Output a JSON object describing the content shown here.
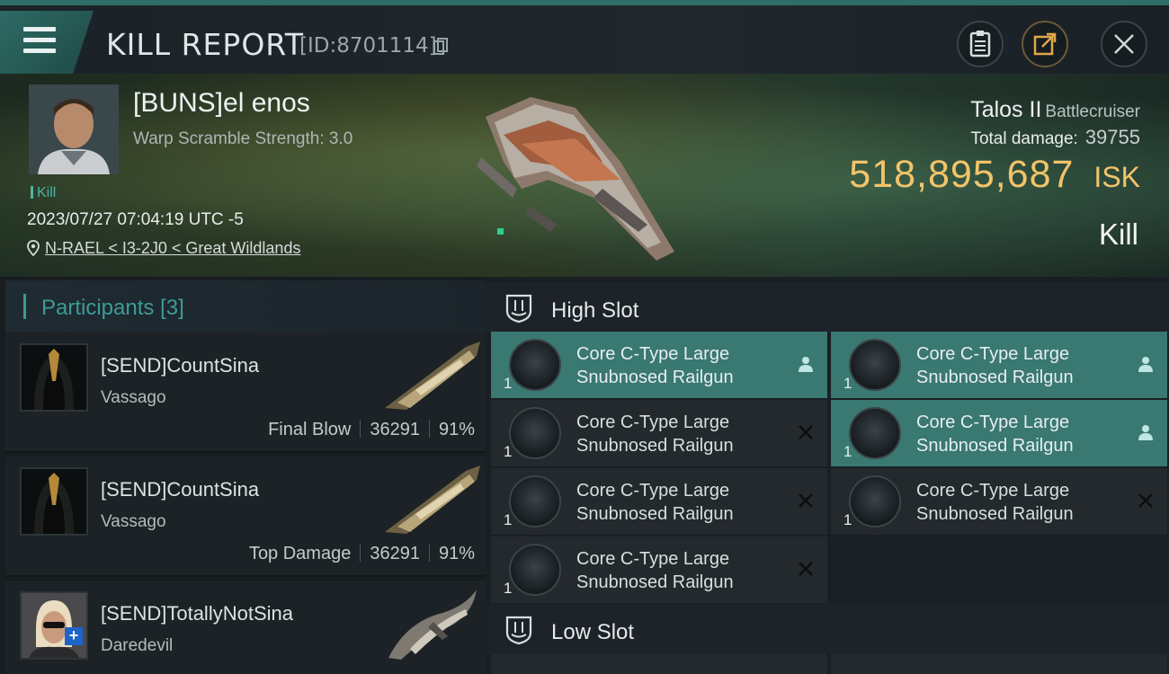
{
  "header": {
    "title": "KILL REPORT",
    "report_id": "[ID:8701114]"
  },
  "victim": {
    "name": "[BUNS]el enos",
    "detail": "Warp Scramble Strength: 3.0",
    "tag": "Kill",
    "datetime": "2023/07/27 07:04:19 UTC -5",
    "location": "N-RAEL < I3-2J0 < Great Wildlands",
    "ship_name": "Talos II",
    "ship_class": "Battlecruiser",
    "total_damage_label": "Total damage:",
    "total_damage": "39755",
    "isk_value": "518,895,687",
    "isk_unit": "ISK",
    "result": "Kill"
  },
  "participants": {
    "title": "Participants",
    "count": "[3]",
    "items": [
      {
        "name": "[SEND]CountSina",
        "ship": "Vassago",
        "role": "Final Blow",
        "damage": "36291",
        "percent": "91%"
      },
      {
        "name": "[SEND]CountSina",
        "ship": "Vassago",
        "role": "Top Damage",
        "damage": "36291",
        "percent": "91%"
      },
      {
        "name": "[SEND]TotallyNotSina",
        "ship": "Daredevil"
      }
    ]
  },
  "slots": {
    "high": {
      "title": "High Slot",
      "modules": [
        {
          "name_line1": "Core C-Type Large",
          "name_line2": "Snubnosed Railgun",
          "qty": "1",
          "state": "fitted"
        },
        {
          "name_line1": "Core C-Type Large",
          "name_line2": "Snubnosed Railgun",
          "qty": "1",
          "state": "fitted"
        },
        {
          "name_line1": "Core C-Type Large",
          "name_line2": "Snubnosed Railgun",
          "qty": "1",
          "state": "destroyed"
        },
        {
          "name_line1": "Core C-Type Large",
          "name_line2": "Snubnosed Railgun",
          "qty": "1",
          "state": "fitted"
        },
        {
          "name_line1": "Core C-Type Large",
          "name_line2": "Snubnosed Railgun",
          "qty": "1",
          "state": "destroyed"
        },
        {
          "name_line1": "Core C-Type Large",
          "name_line2": "Snubnosed Railgun",
          "qty": "1",
          "state": "destroyed"
        },
        {
          "name_line1": "Core C-Type Large",
          "name_line2": "Snubnosed Railgun",
          "qty": "1",
          "state": "destroyed"
        }
      ]
    },
    "low": {
      "title": "Low Slot"
    }
  },
  "colors": {
    "accent": "#3e9c96",
    "isk": "#f2c46a",
    "fitted_row": "#3a7872"
  },
  "icons": [
    "menu-icon",
    "copy-icon",
    "clipboard-icon",
    "share-icon",
    "close-icon",
    "location-pin-icon",
    "high-slot-icon",
    "low-slot-icon",
    "pilot-icon",
    "destroyed-x-icon"
  ]
}
